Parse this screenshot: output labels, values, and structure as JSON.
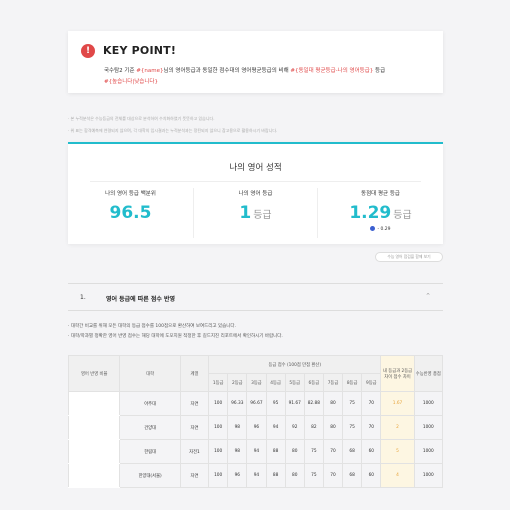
{
  "keypoint": {
    "icon": "alert-icon",
    "title": "KEY POINT!",
    "line1_pre": "국수탐2 기준 ",
    "line1_name": "#{name}",
    "line1_mid": "님의 영어등급과 동일한 점수대의 영어평균등급의 비해 ",
    "line1_hl": "#{동일대 평균등급-나의 영어등급}",
    "line1_post": " 등급",
    "line2": "#{높습니다|낮습니다}"
  },
  "notes": [
    "· 본 누적분석은 수능등급의 전체를 대상으로 분석하여 수치화하였기 뜻뜻하고 있습니다.",
    "· 위 표는 합격예측에 연령되지 않으며, 각 대학의 입시결과는 누적분석과는 정된되지 않으니 참고용으로 활용하시기 바랍니다."
  ],
  "scorecard": {
    "title": "나의 영어 성적",
    "cols": [
      {
        "label": "나의 영어 등급 백분위",
        "value": "96.5",
        "unit": ""
      },
      {
        "label": "나의 영어 등급",
        "value": "1",
        "unit": "등급"
      },
      {
        "label": "동점대 평균 등급",
        "value": "1.29",
        "unit": "등급",
        "delta": "- 0.29"
      }
    ]
  },
  "compare_button": "수능 영어 점검을 함께 보기",
  "section": {
    "num": "1.",
    "title": "영어 등급에 따른 점수 반영"
  },
  "bullets": [
    "· 대학간 비교를 위해 모든 대학의 등급 점수를 100점으로 환산하여 보여드리고 있습니다.",
    "· 대학/학과별 정확한 영어 반영 점수는 해당 대학에 도모지원 적정한 후 길드지진 리포트에서 확인하시기 바랍니다."
  ],
  "table": {
    "headers": {
      "ratio": "영어 반영 비율",
      "univ": "대학",
      "track": "계열",
      "group": "등급 점수 (100점 만점 환산)",
      "my": "내 등급과 2등급 차이 점수 차이",
      "suneung": "수능반영 총점"
    },
    "grades": [
      "1등급",
      "2등급",
      "3등급",
      "4등급",
      "5등급",
      "6등급",
      "7등급",
      "8등급",
      "9등급"
    ],
    "rows": [
      {
        "univ": "아주대",
        "track": "자연",
        "scores": [
          "100",
          "96.33",
          "96.67",
          "95",
          "91.67",
          "82.88",
          "80",
          "75",
          "70"
        ],
        "diff": "1.67",
        "total": "1000"
      },
      {
        "univ": "건양대",
        "track": "자연",
        "scores": [
          "100",
          "98",
          "96",
          "94",
          "92",
          "82",
          "80",
          "75",
          "70"
        ],
        "diff": "2",
        "total": "1000"
      },
      {
        "univ": "한림대",
        "track": "자전1",
        "scores": [
          "100",
          "98",
          "94",
          "88",
          "80",
          "75",
          "70",
          "68",
          "60"
        ],
        "diff": "5",
        "total": "1000"
      },
      {
        "univ": "한양대(서울)",
        "track": "자연",
        "scores": [
          "100",
          "96",
          "94",
          "88",
          "80",
          "75",
          "70",
          "68",
          "60"
        ],
        "diff": "4",
        "total": "1000"
      }
    ]
  }
}
